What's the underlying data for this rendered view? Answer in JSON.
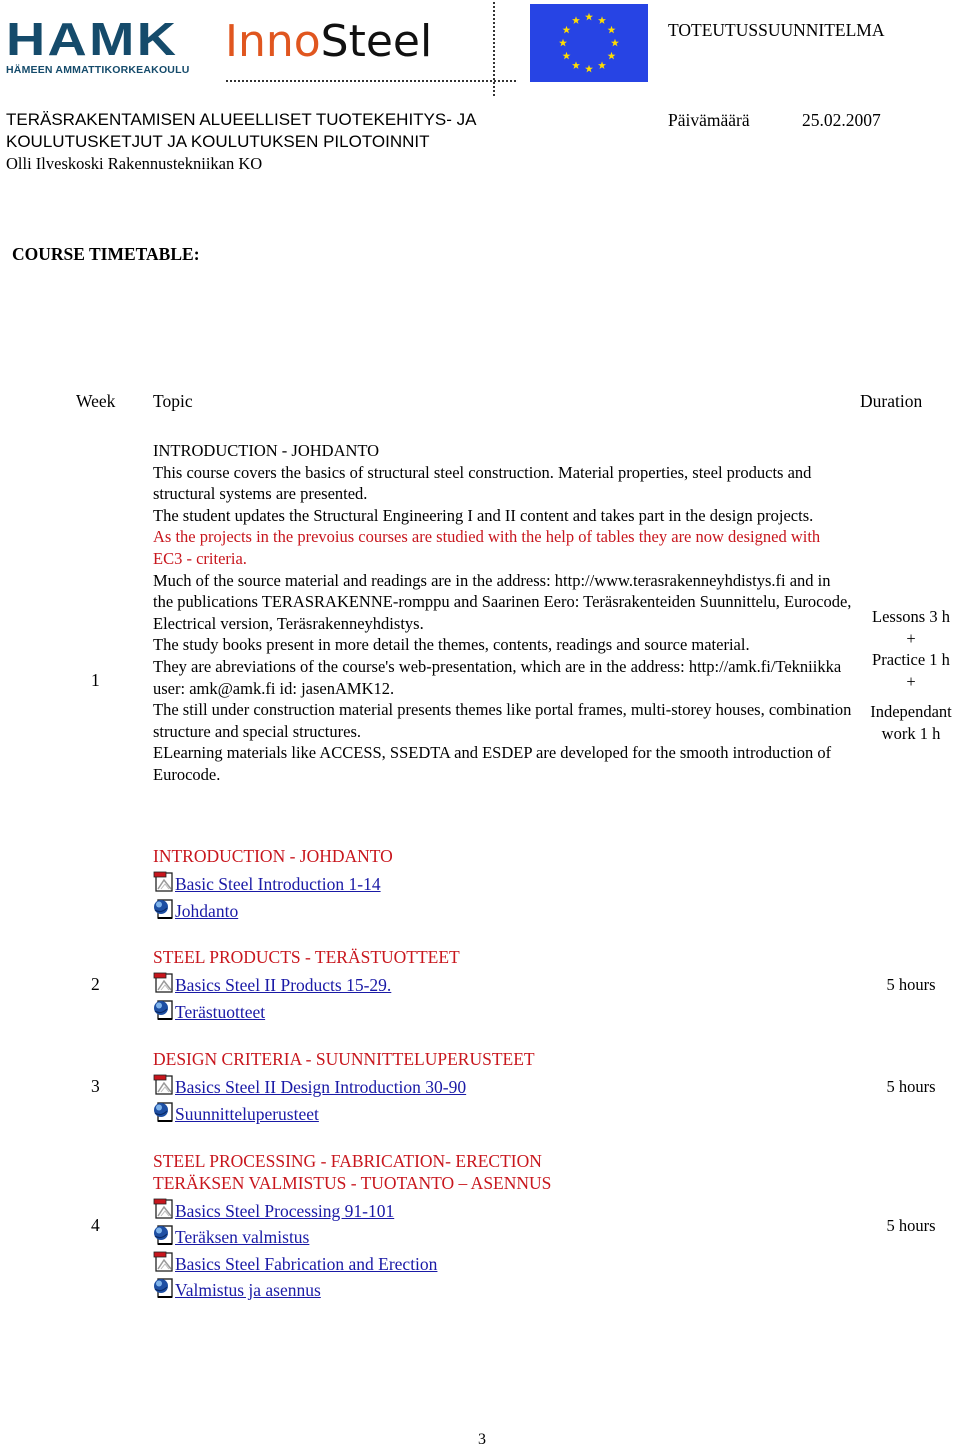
{
  "header": {
    "logo_hamk": "HAMK",
    "logo_hamk_sub": "HÄMEEN AMMATTIKORKEAKOULU",
    "logo_inno": "Inno",
    "logo_steel": "Steel",
    "eu_flag": "eu-flag-icon",
    "doc_type": "TOTEUTUSSUUNNITELMA",
    "date_label": "Päivämäärä",
    "date_value": "25.02.2007",
    "org_line1": "TERÄSRAKENTAMISEN ALUEELLISET TUOTEKEHITYS- JA",
    "org_line2": "KOULUTUSKETJUT JA KOULUTUKSEN PILOTOINNIT",
    "author": "Olli Ilveskoski  Rakennustekniikan KO"
  },
  "section_title": "COURSE TIMETABLE:",
  "table": {
    "columns": [
      "Week",
      "Topic",
      "Duration"
    ],
    "week1": {
      "week": "1",
      "title": "INTRODUCTION - JOHDANTO",
      "paragraphs": [
        {
          "text": "This course  covers the basics of structural steel construction. Material properties, steel products and structural systems are presented.",
          "color": "black"
        },
        {
          "text": "The student updates  the Structural Engineering I and II content and takes part in the design projects.",
          "color": "black"
        },
        {
          "text": "As the projects in the prevoius courses are studied with the help of tables  they are now designed with EC3  - criteria.",
          "color": "red"
        },
        {
          "text": "Much of the source material and readings are in the address: http://www.terasrakenneyhdistys.fi and in the publications TERASRAKENNE-romppu and Saarinen Eero: Teräsrakenteiden Suunnittelu, Eurocode, Electrical version, Teräsrakenneyhdistys.",
          "color": "black"
        },
        {
          "text": "The study books present in more detail the themes, contents, readings and source material.",
          "color": "black"
        },
        {
          "text": "They are abreviations of the course's web-presentation, which are in the address: http://amk.fi/Tekniikka user: amk@amk.fi id: jasenAMK12.",
          "color": "black"
        },
        {
          "text": "The still under construction material presents themes like portal frames, multi-storey houses, combination structure and special structures.",
          "color": "black"
        },
        {
          "text": "ELearning materials like ACCESS, SSEDTA and ESDEP are developed for the smooth introduction of Eurocode.",
          "color": "black"
        }
      ],
      "duration_lines": [
        "Lessons 3 h",
        "+",
        "Practice 1 h",
        "+",
        "Independant",
        "work  1 h"
      ],
      "resources_title": "INTRODUCTION - JOHDANTO",
      "links": [
        {
          "icon": "pdf-icon",
          "label": "Basic Steel Introduction 1-14"
        },
        {
          "icon": "web-page-icon",
          "label": "Johdanto"
        }
      ]
    },
    "week2": {
      "week": "2",
      "title": "STEEL PRODUCTS - TERÄSTUOTTEET",
      "links": [
        {
          "icon": "pdf-icon",
          "label": "Basics Steel II Products 15-29."
        },
        {
          "icon": "web-page-icon",
          "label": "Terästuotteet"
        }
      ],
      "duration": "5 hours"
    },
    "week3": {
      "week": "3",
      "title": "DESIGN CRITERIA - SUUNNITTELUPERUSTEET",
      "links": [
        {
          "icon": "pdf-icon",
          "label": "Basics Steel II Design Introduction 30-90"
        },
        {
          "icon": "web-page-icon",
          "label": "Suunnitteluperusteet"
        }
      ],
      "duration": "5 hours"
    },
    "week4": {
      "week": "4",
      "title_line1": "STEEL PROCESSING - FABRICATION- ERECTION",
      "title_line2": "TERÄKSEN VALMISTUS - TUOTANTO – ASENNUS",
      "links": [
        {
          "icon": "pdf-icon",
          "label": "Basics Steel Processing 91-101"
        },
        {
          "icon": "web-page-icon",
          "label": "Teräksen valmistus"
        },
        {
          "icon": "pdf-icon",
          "label": "Basics Steel Fabrication and Erection"
        },
        {
          "icon": "web-page-icon",
          "label": "Valmistus ja asennus"
        }
      ],
      "duration": "5 hours"
    }
  },
  "colors": {
    "heading_red": "#c8161d",
    "link_blue": "#1a1aa6",
    "hamk_blue": "#154b6b",
    "inno_orange": "#e0561f",
    "eu_blue": "#2744e4",
    "eu_star": "#ffdd00"
  },
  "page_number": "3"
}
